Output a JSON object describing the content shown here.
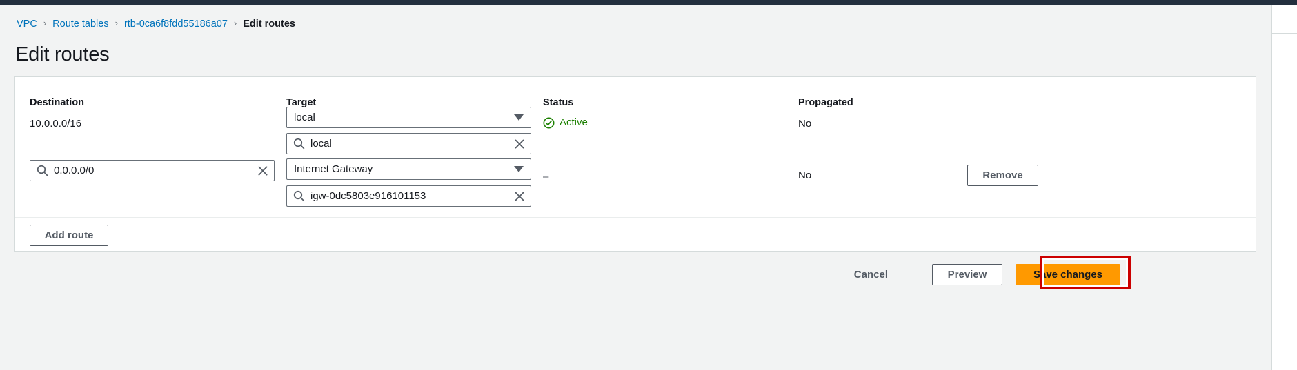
{
  "breadcrumb": {
    "items": [
      {
        "label": "VPC",
        "type": "link"
      },
      {
        "label": "Route tables",
        "type": "link"
      },
      {
        "label": "rtb-0ca6f8fdd55186a07",
        "type": "link"
      },
      {
        "label": "Edit routes",
        "type": "current"
      }
    ],
    "separator": "›"
  },
  "page": {
    "title": "Edit routes"
  },
  "routes_table": {
    "columns": [
      {
        "key": "destination",
        "label": "Destination"
      },
      {
        "key": "target",
        "label": "Target"
      },
      {
        "key": "status",
        "label": "Status"
      },
      {
        "key": "propagated",
        "label": "Propagated"
      },
      {
        "key": "action",
        "label": ""
      }
    ],
    "rows": [
      {
        "destination_value": "10.0.0.0/16",
        "destination_editable": false,
        "target_select_value": "local",
        "target_search_value": "local",
        "status_text": "Active",
        "status_icon": "check-circle-icon",
        "propagated": "No",
        "action_label": ""
      },
      {
        "destination_value": "0.0.0.0/0",
        "destination_editable": true,
        "target_select_value": "Internet Gateway",
        "target_search_value": "igw-0dc5803e916101153",
        "status_text": "–",
        "status_icon": "",
        "propagated": "No",
        "action_label": "Remove"
      }
    ],
    "add_route_label": "Add route"
  },
  "footer_actions": {
    "cancel_label": "Cancel",
    "preview_label": "Preview",
    "save_label": "Save changes"
  },
  "icons": {
    "search": "search-icon",
    "clear": "clear-icon",
    "dropdown": "chevron-down-icon",
    "status_active": "check-circle-icon"
  },
  "colors": {
    "link": "#0073bb",
    "primary_button": "#ff9900",
    "status_active": "#1d8102",
    "highlight_outline": "#cc0000",
    "page_background": "#f2f3f3",
    "top_bar": "#232f3e"
  }
}
